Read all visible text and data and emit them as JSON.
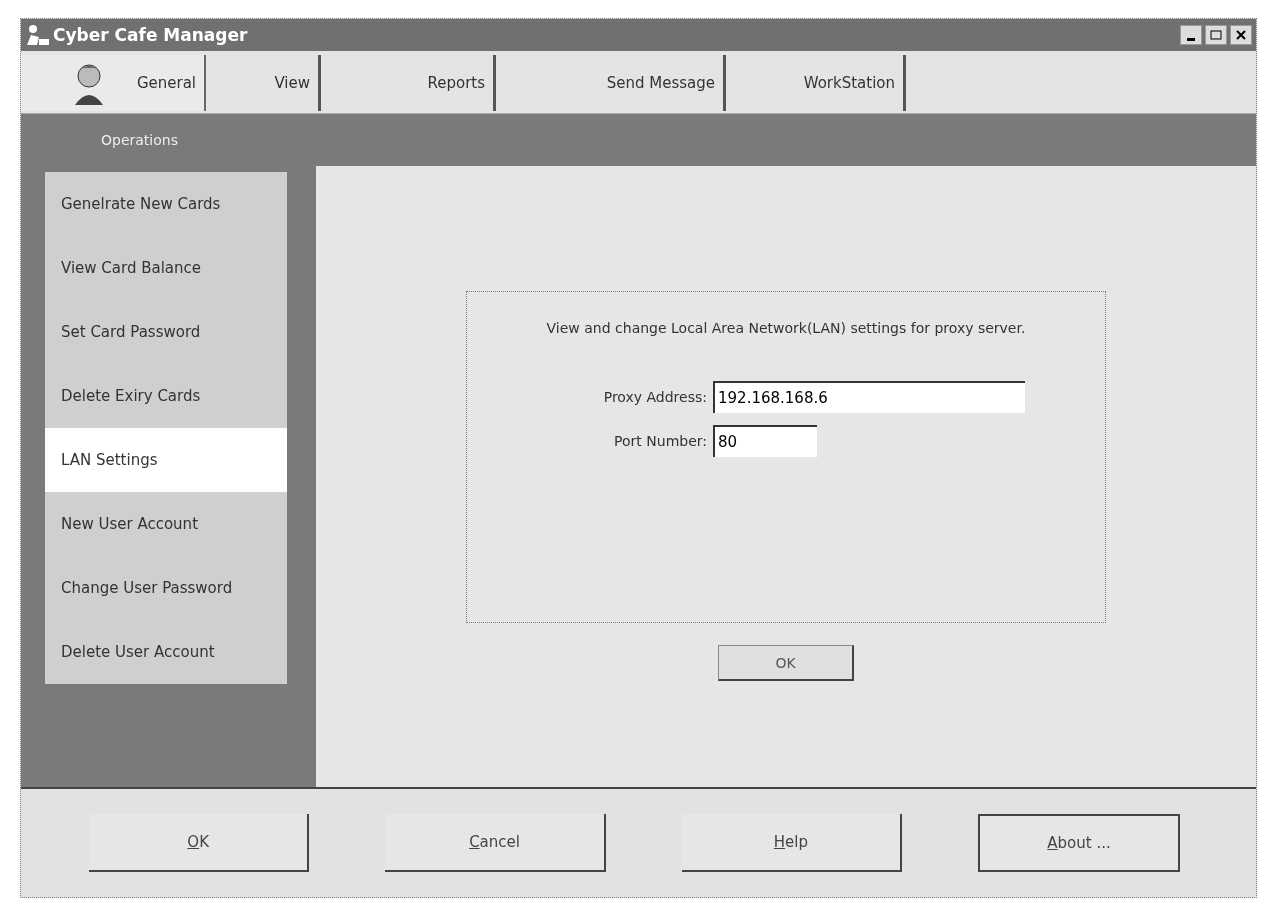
{
  "window": {
    "title": "Cyber Cafe Manager"
  },
  "tabs": [
    {
      "label": "General",
      "selected": true,
      "kind": "avatar"
    },
    {
      "label": "View",
      "selected": false
    },
    {
      "label": "Reports",
      "selected": false
    },
    {
      "label": "Send Message",
      "selected": false
    },
    {
      "label": "WorkStation",
      "selected": false
    }
  ],
  "sidebar": {
    "title": "Operations",
    "items": [
      {
        "label": "Genelrate New Cards",
        "selected": false
      },
      {
        "label": "View Card Balance",
        "selected": false
      },
      {
        "label": "Set Card Password",
        "selected": false
      },
      {
        "label": "Delete Exiry Cards",
        "selected": false
      },
      {
        "label": "LAN Settings",
        "selected": true
      },
      {
        "label": "New User Account",
        "selected": false
      },
      {
        "label": "Change User Password",
        "selected": false
      },
      {
        "label": "Delete User Account",
        "selected": false
      }
    ]
  },
  "lan_settings": {
    "description": "View and change Local Area Network(LAN) settings for proxy server.",
    "fields": [
      {
        "label": "Proxy Address:",
        "value": "192.168.168.6",
        "kind": "wide"
      },
      {
        "label": "Port Number:",
        "value": "80",
        "kind": "narrow"
      }
    ],
    "ok_button": "OK"
  },
  "buttons": [
    {
      "key": "O",
      "rest": "K"
    },
    {
      "key": "C",
      "rest": "ancel"
    },
    {
      "key": "H",
      "rest": "elp"
    },
    {
      "key": "A",
      "rest": "bout ..."
    }
  ]
}
